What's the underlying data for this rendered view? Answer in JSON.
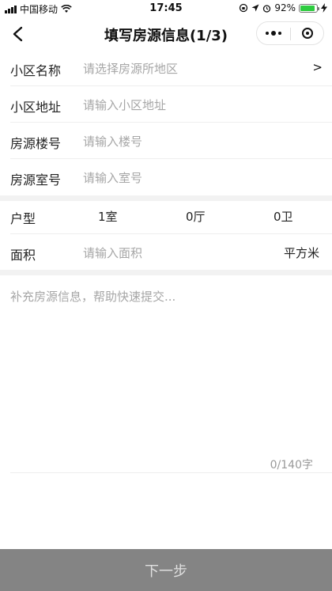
{
  "status_bar": {
    "carrier": "中国移动",
    "time": "17:45",
    "battery_percent": "92%",
    "battery_level": 0.92
  },
  "nav": {
    "title": "填写房源信息(1/3)"
  },
  "form": {
    "community_name": {
      "label": "小区名称",
      "placeholder": "请选择房源所地区",
      "chevron": ">"
    },
    "community_address": {
      "label": "小区地址",
      "placeholder": "请输入小区地址"
    },
    "building_no": {
      "label": "房源楼号",
      "placeholder": "请输入楼号"
    },
    "room_no": {
      "label": "房源室号",
      "placeholder": "请输入室号"
    },
    "layout": {
      "label": "户型",
      "rooms": "1室",
      "halls": "0厅",
      "baths": "0卫"
    },
    "area": {
      "label": "面积",
      "placeholder": "请输入面积",
      "unit": "平方米"
    }
  },
  "supplement": {
    "placeholder": "补充房源信息，帮助快速提交...",
    "counter": "0/140字"
  },
  "footer": {
    "next_label": "下一步"
  },
  "colors": {
    "button_bg": "#848484",
    "placeholder": "#a6a6a6",
    "battery_green": "#2ecc40"
  }
}
